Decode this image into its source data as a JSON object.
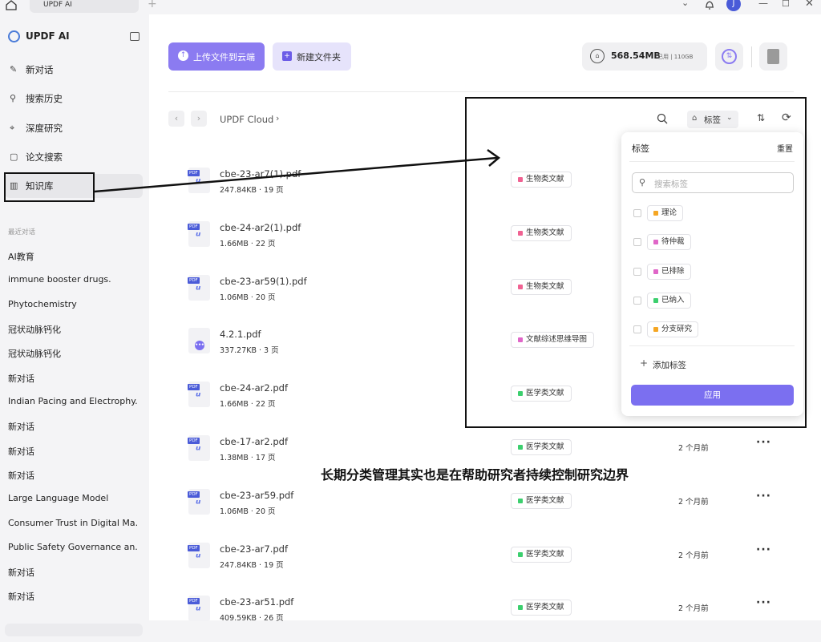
{
  "window": {
    "tab_title": "UPDF AI",
    "avatar_initial": "J"
  },
  "sidebar": {
    "brand": "UPDF AI",
    "nav": [
      {
        "label": "新对话",
        "icon": "edit-icon"
      },
      {
        "label": "搜索历史",
        "icon": "search-icon"
      },
      {
        "label": "深度研究",
        "icon": "telescope-icon"
      },
      {
        "label": "论文搜索",
        "icon": "paper-search-icon"
      },
      {
        "label": "知识库",
        "icon": "library-icon",
        "active": true
      }
    ],
    "recent_title": "最近对话",
    "recent": [
      "AI教育",
      "immune booster drugs.",
      "Phytochemistry",
      "冠状动脉钙化",
      "冠状动脉钙化",
      "新对话",
      "Indian Pacing and Electrophy...",
      "新对话",
      "新对话",
      "新对话",
      "Large Language Model",
      "Consumer Trust in Digital Ma...",
      "Public Safety Governance an...",
      "新对话",
      "新对话"
    ]
  },
  "toolbar": {
    "upload_label": "上传文件到云端",
    "new_folder_label": "新建文件夹",
    "storage_used": "568.54MB",
    "storage_detail": "已用 | 110GB"
  },
  "breadcrumb": {
    "root": "UPDF Cloud"
  },
  "filter": {
    "tag_button": "标签"
  },
  "files": [
    {
      "name": "cbe-23-ar7(1).pdf",
      "meta": "247.84KB · 19 页",
      "tag": "生物类文献",
      "tag_color": "#f06292",
      "date": "",
      "type": "pdf"
    },
    {
      "name": "cbe-24-ar2(1).pdf",
      "meta": "1.66MB · 22 页",
      "tag": "生物类文献",
      "tag_color": "#f06292",
      "date": "",
      "type": "pdf"
    },
    {
      "name": "cbe-23-ar59(1).pdf",
      "meta": "1.06MB · 20 页",
      "tag": "生物类文献",
      "tag_color": "#f06292",
      "date": "",
      "type": "pdf"
    },
    {
      "name": "4.2.1.pdf",
      "meta": "337.27KB · 3 页",
      "tag": "文献综述思维导图",
      "tag_color": "#e066c8",
      "date": "",
      "type": "doc"
    },
    {
      "name": "cbe-24-ar2.pdf",
      "meta": "1.66MB · 22 页",
      "tag": "医学类文献",
      "tag_color": "#3ccf6e",
      "date": "",
      "type": "pdf"
    },
    {
      "name": "cbe-17-ar2.pdf",
      "meta": "1.38MB · 17 页",
      "tag": "医学类文献",
      "tag_color": "#3ccf6e",
      "date": "2 个月前",
      "type": "pdf"
    },
    {
      "name": "cbe-23-ar59.pdf",
      "meta": "1.06MB · 20 页",
      "tag": "医学类文献",
      "tag_color": "#3ccf6e",
      "date": "2 个月前",
      "type": "pdf"
    },
    {
      "name": "cbe-23-ar7.pdf",
      "meta": "247.84KB · 19 页",
      "tag": "医学类文献",
      "tag_color": "#3ccf6e",
      "date": "2 个月前",
      "type": "pdf"
    },
    {
      "name": "cbe-23-ar51.pdf",
      "meta": "409.59KB · 26 页",
      "tag": "医学类文献",
      "tag_color": "#3ccf6e",
      "date": "2 个月前",
      "type": "pdf"
    }
  ],
  "tag_dropdown": {
    "title": "标签",
    "reset": "重置",
    "search_placeholder": "搜索标签",
    "tags": [
      {
        "label": "理论",
        "color": "#f5a623"
      },
      {
        "label": "待仲裁",
        "color": "#e066c8"
      },
      {
        "label": "已排除",
        "color": "#e066c8"
      },
      {
        "label": "已纳入",
        "color": "#3ccf6e"
      },
      {
        "label": "分支研究",
        "color": "#f5a623"
      }
    ],
    "add_label": "添加标签",
    "apply_label": "应用"
  },
  "caption": "长期分类管理其实也是在帮助研究者持续控制研究边界",
  "file_icon_label": "PDF"
}
